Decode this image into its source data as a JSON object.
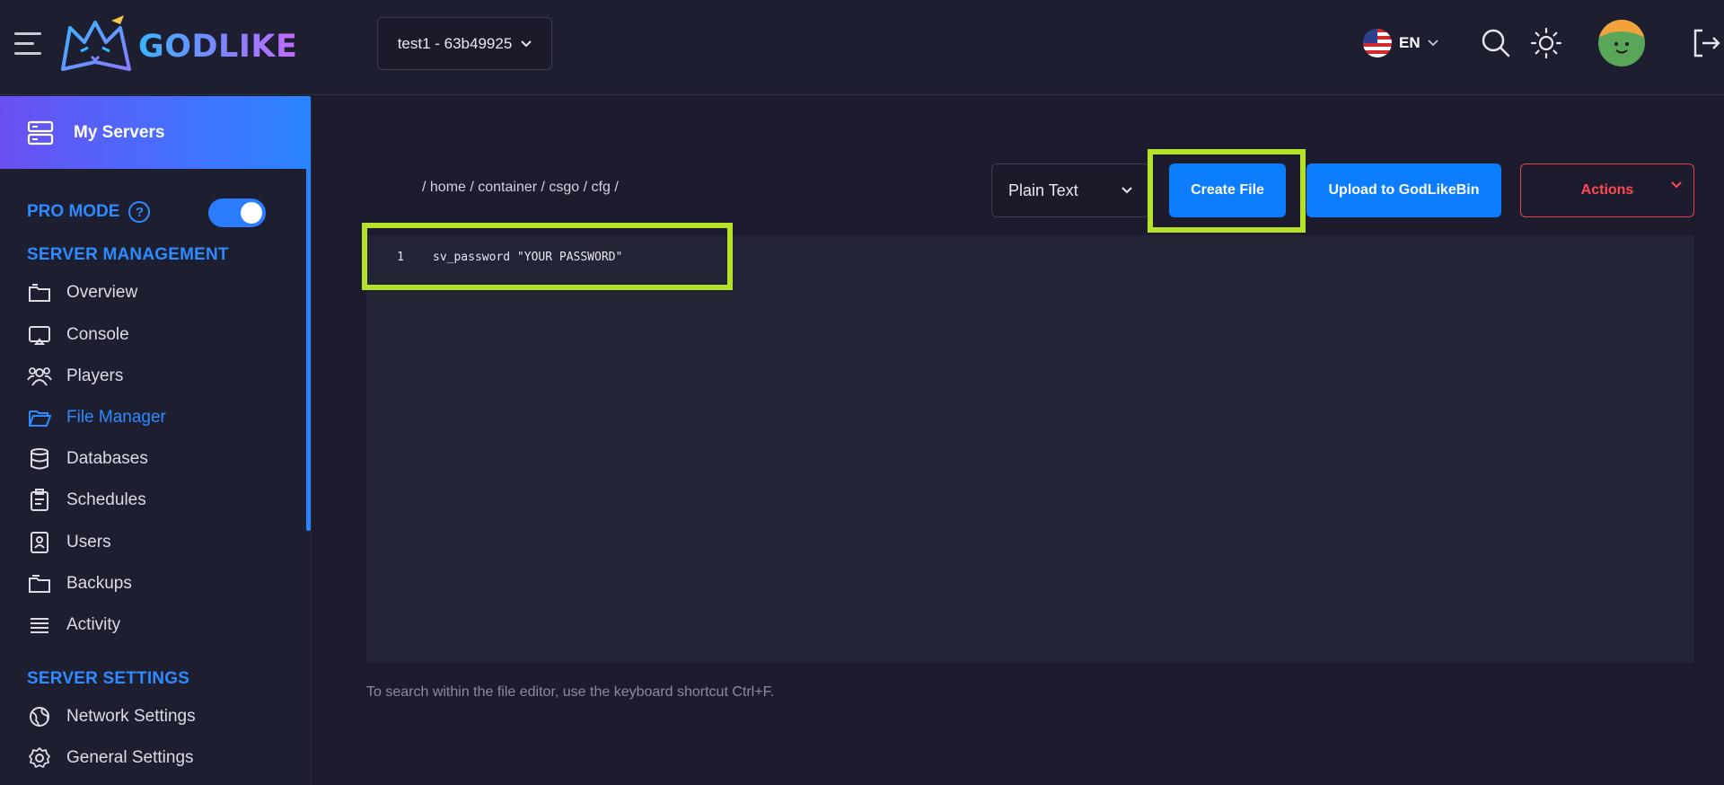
{
  "brand": {
    "name": "GODLIKE"
  },
  "header": {
    "server_select": "test1 - 63b49925",
    "language": "EN"
  },
  "sidebar": {
    "my_servers": "My Servers",
    "pro_mode": "PRO MODE",
    "help": "?",
    "section_management": "SERVER MANAGEMENT",
    "items": [
      {
        "label": "Overview",
        "icon": "folder-icon"
      },
      {
        "label": "Console",
        "icon": "console-icon"
      },
      {
        "label": "Players",
        "icon": "players-icon"
      },
      {
        "label": "File Manager",
        "icon": "folder-open-icon"
      },
      {
        "label": "Databases",
        "icon": "database-icon"
      },
      {
        "label": "Schedules",
        "icon": "clipboard-icon"
      },
      {
        "label": "Users",
        "icon": "user-card-icon"
      },
      {
        "label": "Backups",
        "icon": "backup-icon"
      },
      {
        "label": "Activity",
        "icon": "list-icon"
      }
    ],
    "section_settings": "SERVER SETTINGS",
    "settings_items": [
      {
        "label": "Network Settings",
        "icon": "globe-icon"
      },
      {
        "label": "General Settings",
        "icon": "gear-icon"
      }
    ]
  },
  "editor": {
    "path": "/ home / container / csgo / cfg /",
    "mode": "Plain Text",
    "create_file": "Create File",
    "upload": "Upload to GodLikeBin",
    "actions": "Actions",
    "lines": [
      {
        "num": "1",
        "text": "sv_password \"YOUR PASSWORD\""
      }
    ],
    "hint": "To search within the file editor, use the keyboard shortcut Ctrl+F."
  },
  "colors": {
    "accent": "#2e8bff",
    "highlight": "#b6e12b",
    "danger": "#ff4a52",
    "background": "#1c1c2e"
  }
}
